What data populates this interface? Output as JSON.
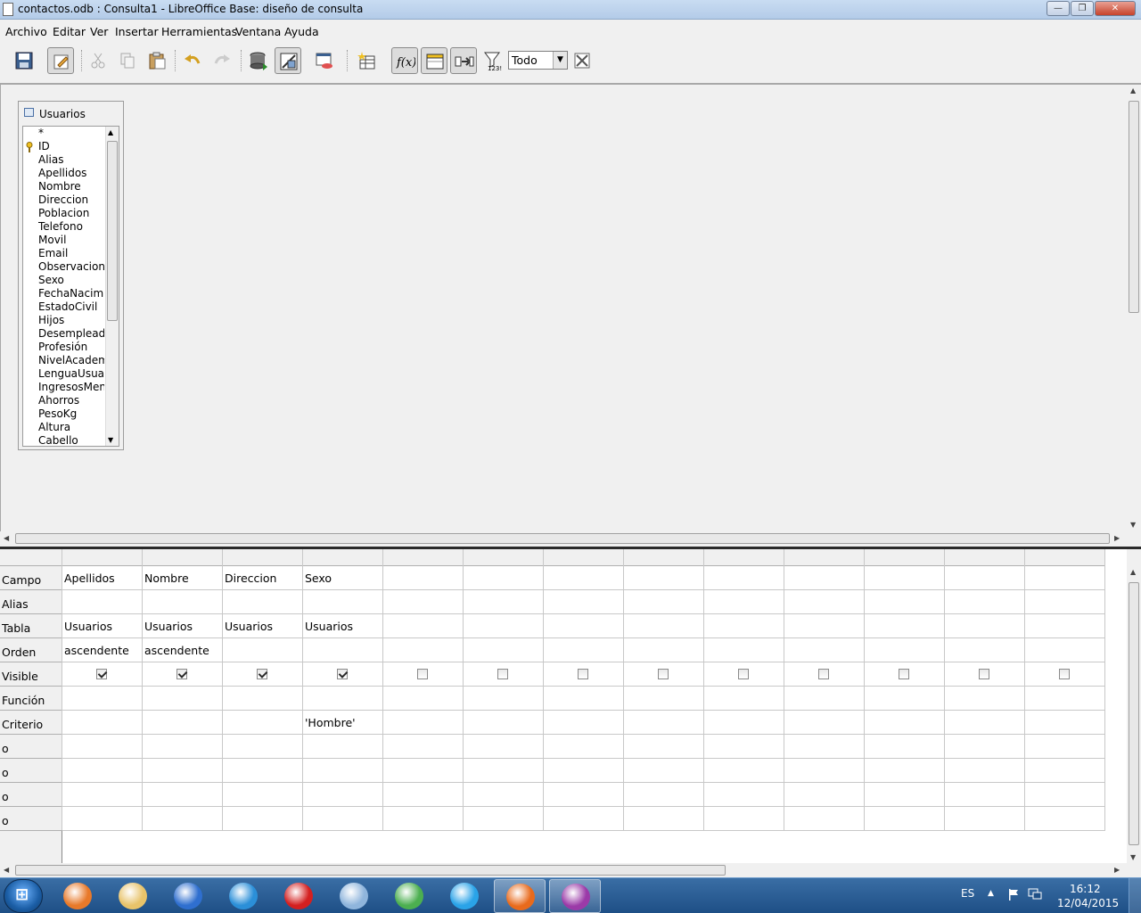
{
  "window": {
    "title": "contactos.odb : Consulta1 - LibreOffice Base: diseño de consulta",
    "minimize_label": "—",
    "maximize_label": "❐",
    "close_label": "✕"
  },
  "menu": {
    "items": [
      {
        "label": "Archivo"
      },
      {
        "label": "Editar"
      },
      {
        "label": "Ver"
      },
      {
        "label": "Insertar"
      },
      {
        "label": "Herramientas"
      },
      {
        "label": "Ventana"
      },
      {
        "label": "Ayuda"
      }
    ]
  },
  "toolbar": {
    "limit_value": "Todo",
    "icons": [
      "save-icon",
      "edit-mode-icon",
      "cut-icon",
      "copy-icon",
      "paste-icon",
      "undo-icon",
      "redo-icon",
      "run-query-icon",
      "design-view-icon",
      "clear-query-icon",
      "add-table-icon",
      "functions-icon",
      "table-names-icon",
      "alias-icon",
      "distinct-values-icon",
      "limit-dropdown",
      "sql-native-icon"
    ]
  },
  "table_window": {
    "name": "Usuarios",
    "fields": [
      "*",
      "ID",
      "Alias",
      "Apellidos",
      "Nombre",
      "Direccion",
      "Poblacion",
      "Telefono",
      "Movil",
      "Email",
      "Observaciones",
      "Sexo",
      "FechaNacimiento",
      "EstadoCivil",
      "Hijos",
      "Desempleado",
      "Profesión",
      "NivelAcademico",
      "LenguaUsual",
      "IngresosMensuales",
      "Ahorros",
      "PesoKg",
      "Altura",
      "Cabello"
    ],
    "primary_key": "ID"
  },
  "grid": {
    "row_labels": [
      "Campo",
      "Alias",
      "Tabla",
      "Orden",
      "Visible",
      "Función",
      "Criterio",
      "o",
      "o",
      "o",
      "o"
    ],
    "columns": [
      {
        "campo": "Apellidos",
        "alias": "",
        "tabla": "Usuarios",
        "orden": "ascendente",
        "visible": true,
        "funcion": "",
        "criterio": ""
      },
      {
        "campo": "Nombre",
        "alias": "",
        "tabla": "Usuarios",
        "orden": "ascendente",
        "visible": true,
        "funcion": "",
        "criterio": ""
      },
      {
        "campo": "Direccion",
        "alias": "",
        "tabla": "Usuarios",
        "orden": "",
        "visible": true,
        "funcion": "",
        "criterio": ""
      },
      {
        "campo": "Sexo",
        "alias": "",
        "tabla": "Usuarios",
        "orden": "",
        "visible": true,
        "funcion": "",
        "criterio": "'Hombre'"
      },
      {
        "campo": "",
        "alias": "",
        "tabla": "",
        "orden": "",
        "visible": false,
        "funcion": "",
        "criterio": ""
      },
      {
        "campo": "",
        "alias": "",
        "tabla": "",
        "orden": "",
        "visible": false,
        "funcion": "",
        "criterio": ""
      },
      {
        "campo": "",
        "alias": "",
        "tabla": "",
        "orden": "",
        "visible": false,
        "funcion": "",
        "criterio": ""
      },
      {
        "campo": "",
        "alias": "",
        "tabla": "",
        "orden": "",
        "visible": false,
        "funcion": "",
        "criterio": ""
      },
      {
        "campo": "",
        "alias": "",
        "tabla": "",
        "orden": "",
        "visible": false,
        "funcion": "",
        "criterio": ""
      },
      {
        "campo": "",
        "alias": "",
        "tabla": "",
        "orden": "",
        "visible": false,
        "funcion": "",
        "criterio": ""
      },
      {
        "campo": "",
        "alias": "",
        "tabla": "",
        "orden": "",
        "visible": false,
        "funcion": "",
        "criterio": ""
      },
      {
        "campo": "",
        "alias": "",
        "tabla": "",
        "orden": "",
        "visible": false,
        "funcion": "",
        "criterio": ""
      },
      {
        "campo": "",
        "alias": "",
        "tabla": "",
        "orden": "",
        "visible": false,
        "funcion": "",
        "criterio": ""
      }
    ]
  },
  "taskbar": {
    "start_label": "⊞",
    "apps": [
      {
        "name": "media-player-icon",
        "color": "#e8792a"
      },
      {
        "name": "file-explorer-icon",
        "color": "#e8c36a"
      },
      {
        "name": "google-earth-icon",
        "color": "#2f6fcf"
      },
      {
        "name": "maxthon-icon",
        "color": "#2b8fd8"
      },
      {
        "name": "opera-icon",
        "color": "#d42020"
      },
      {
        "name": "safari-icon",
        "color": "#8fb5dc"
      },
      {
        "name": "chrome-icon",
        "color": "#4caf50"
      },
      {
        "name": "internet-explorer-icon",
        "color": "#2aa3e8"
      },
      {
        "name": "firefox-icon",
        "color": "#e86a1c"
      },
      {
        "name": "libreoffice-base-icon",
        "color": "#9b3aa8"
      }
    ],
    "language": "ES",
    "time": "16:12",
    "date": "12/04/2015"
  }
}
